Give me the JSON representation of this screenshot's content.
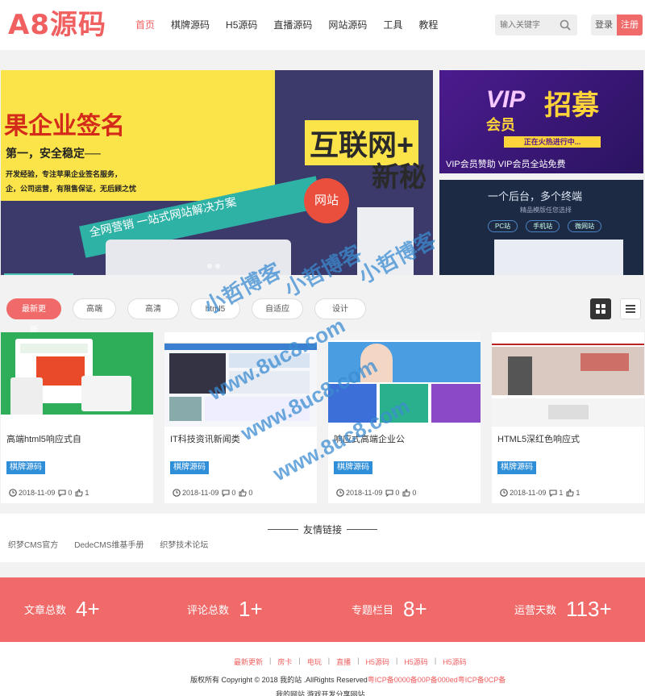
{
  "header": {
    "logo": "A8源码",
    "nav": [
      "首页",
      "棋牌源码",
      "H5源码",
      "直播源码",
      "网站源码",
      "工具",
      "教程"
    ],
    "search_placeholder": "输入关键字",
    "login": "登录",
    "register": "注册"
  },
  "banners": {
    "main": {
      "title": "果企业签名",
      "sub1": "第一，安全稳定──",
      "sub2": "开发经验，专注苹果企业签名服务，",
      "sub3": "企，公司运营，有限售保证，无后顾之忧",
      "headline1": "互联网+",
      "headline2": "新秘",
      "marketing": "全网营销 一站式网站解决方案",
      "website": "网站"
    },
    "vip": {
      "vip": "VIP",
      "recruit": "招募",
      "member": "会员",
      "ribbon": "正在火热进行中...",
      "caption": "VIP会员赞助 VIP会员全站免费"
    },
    "multi": {
      "title": "一个后台，多个终端",
      "subtitle": "精品模版任您选择",
      "tags": [
        "PC站",
        "手机站",
        "微网站"
      ]
    }
  },
  "filters": [
    "最新更新",
    "高端",
    "高清",
    "html5",
    "自适应",
    "设计"
  ],
  "cards": [
    {
      "title": "高端html5响应式自",
      "tag": "棋牌源码",
      "date": "2018-11-09",
      "comments": "0",
      "likes": "1"
    },
    {
      "title": "IT科技资讯新闻类",
      "tag": "棋牌源码",
      "date": "2018-11-09",
      "comments": "0",
      "likes": "0"
    },
    {
      "title": "响应式高端企业公",
      "tag": "棋牌源码",
      "date": "2018-11-09",
      "comments": "0",
      "likes": "0"
    },
    {
      "title": "HTML5深红色响应式",
      "tag": "棋牌源码",
      "date": "2018-11-09",
      "comments": "1",
      "likes": "1"
    }
  ],
  "links": {
    "heading": "友情链接",
    "items": [
      "织梦CMS官方",
      "DedeCMS维基手册",
      "织梦技术论坛"
    ]
  },
  "stats": [
    {
      "label": "文章总数",
      "value": "4+"
    },
    {
      "label": "评论总数",
      "value": "1+"
    },
    {
      "label": "专题栏目",
      "value": "8+"
    },
    {
      "label": "运营天数",
      "value": "113+"
    }
  ],
  "footer": {
    "links": [
      "最新更新",
      "房卡",
      "电玩",
      "直播",
      "H5源码",
      "H5源码",
      "H5源码"
    ],
    "copyright": "版权所有 Copyright © 2018 我的站 .AllRights Reserved",
    "icp": "粤ICP备0000备00P备000ed粤ICP备0CP备",
    "desc": "我的网站 游戏开发分享网站"
  },
  "watermark": {
    "line1": "小哲博客",
    "line2": "www.8uc8.com"
  },
  "colors": {
    "accent": "#f06a6a",
    "tag": "#2e8ed8",
    "watermark": "#3c8cd2"
  }
}
